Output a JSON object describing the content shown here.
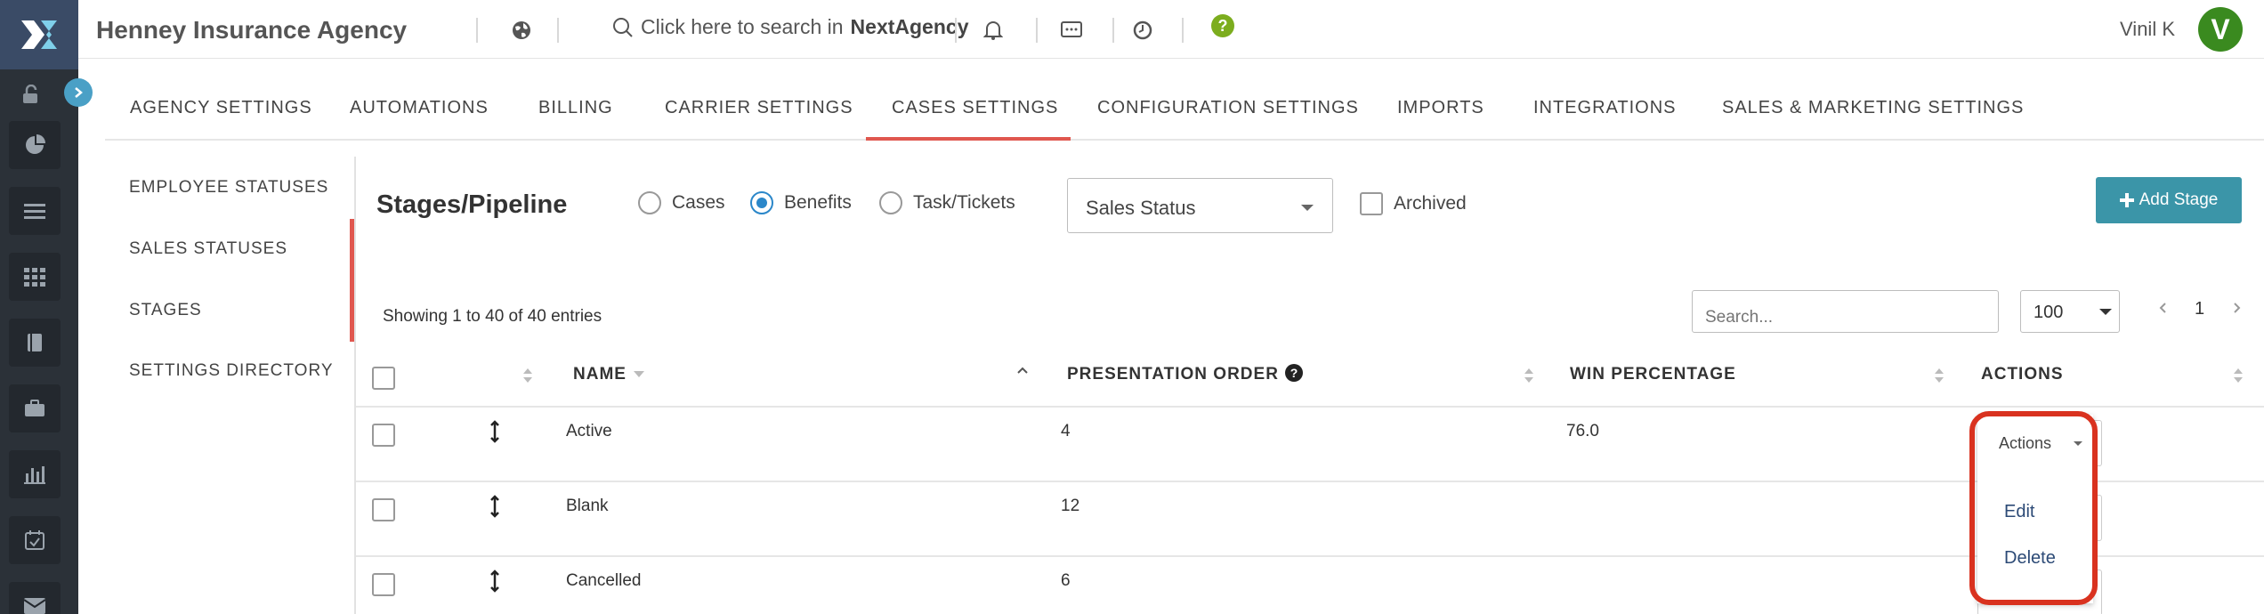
{
  "topbar": {
    "agency_name": "Henney Insurance Agency",
    "search_prefix": "Click here to search in",
    "search_app": "NextAgency",
    "user_name": "Vinil K",
    "avatar_letter": "V"
  },
  "tabs": [
    {
      "label": "AGENCY SETTINGS"
    },
    {
      "label": "AUTOMATIONS"
    },
    {
      "label": "BILLING"
    },
    {
      "label": "CARRIER SETTINGS"
    },
    {
      "label": "CASES SETTINGS"
    },
    {
      "label": "CONFIGURATION SETTINGS"
    },
    {
      "label": "IMPORTS"
    },
    {
      "label": "INTEGRATIONS"
    },
    {
      "label": "SALES & MARKETING SETTINGS"
    }
  ],
  "active_tab": "CASES SETTINGS",
  "sidebar": {
    "items": [
      {
        "label": "EMPLOYEE STATUSES"
      },
      {
        "label": "SALES STATUSES"
      },
      {
        "label": "STAGES"
      },
      {
        "label": "SETTINGS DIRECTORY"
      }
    ]
  },
  "panel": {
    "title": "Stages/Pipeline",
    "radios": [
      {
        "label": "Cases",
        "selected": false
      },
      {
        "label": "Benefits",
        "selected": true
      },
      {
        "label": "Task/Tickets",
        "selected": false
      }
    ],
    "status_select": "Sales Status",
    "archived_label": "Archived",
    "add_button": "Add Stage",
    "showing": "Showing 1 to 40 of 40 entries",
    "search_placeholder": "Search...",
    "page_size": "100",
    "current_page": "1"
  },
  "table": {
    "columns": {
      "name": "NAME",
      "order": "PRESENTATION ORDER",
      "win": "WIN PERCENTAGE",
      "actions": "ACTIONS"
    },
    "rows": [
      {
        "name": "Active",
        "order": "4",
        "win": "76.0"
      },
      {
        "name": "Blank",
        "order": "12",
        "win": ""
      },
      {
        "name": "Cancelled",
        "order": "6",
        "win": ""
      }
    ]
  },
  "actions_menu": {
    "button_label": "Actions",
    "items": [
      {
        "label": "Edit"
      },
      {
        "label": "Delete"
      }
    ]
  },
  "colors": {
    "accent": "#e0574f",
    "primary": "#3b95a8",
    "radio": "#2b87c9",
    "highlight": "#d9321f",
    "avatar": "#3a8a1f"
  }
}
